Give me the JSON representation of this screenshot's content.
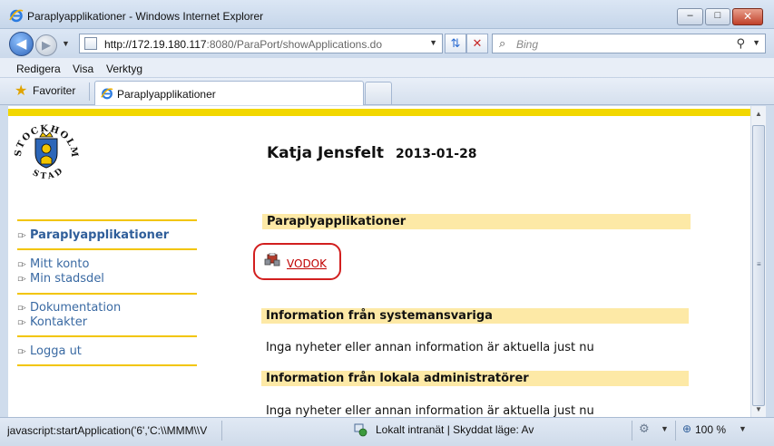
{
  "window": {
    "title": "Paraplyapplikationer - Windows Internet Explorer",
    "controls": {
      "minimize": "–",
      "maximize": "□",
      "close": "✕"
    }
  },
  "navigation": {
    "address_host": "http://172.19.180.117",
    "address_rest": ":8080/ParaPort/showApplications.do",
    "search_placeholder": "Bing",
    "icons": [
      "back-arrow-icon",
      "forward-arrow-icon",
      "refresh-icon",
      "stop-icon",
      "search-icon"
    ]
  },
  "menubar": {
    "items": [
      "Redigera",
      "Visa",
      "Verktyg"
    ]
  },
  "favorites": {
    "label": "Favoriter"
  },
  "tab": {
    "label": "Paraplyapplikationer"
  },
  "page": {
    "logo_text": "STOCKHOLMS STAD",
    "user_name": "Katja Jensfelt",
    "date": "2013-01-28",
    "nav": {
      "items": [
        {
          "label": "Paraplyapplikationer",
          "active": true
        },
        {
          "label": "Mitt konto"
        },
        {
          "label": "Min stadsdel"
        },
        {
          "label": "Dokumentation"
        },
        {
          "label": "Kontakter"
        },
        {
          "label": "Logga ut"
        }
      ],
      "bullet": "▫▹"
    },
    "sections": {
      "apps_header": "Paraplyapplikationer",
      "app_link": "VODOK",
      "sys_header": "Information från systemansvariga",
      "sys_text": "Inga nyheter eller annan information är aktuella just nu",
      "local_header": "Information från lokala administratörer",
      "local_text": "Inga nyheter eller annan information är aktuella just nu"
    }
  },
  "statusbar": {
    "link_text": "javascript:startApplication('6','C:\\\\MMM\\\\V",
    "zone_text": "Lokalt intranät | Skyddat läge: Av",
    "zoom_text": "100 %"
  },
  "colors": {
    "accent_yellow": "#f2d700",
    "header_bg": "#fde9a6",
    "nav_link": "#3a6aa3",
    "highlight_circle": "#d21f1f"
  }
}
